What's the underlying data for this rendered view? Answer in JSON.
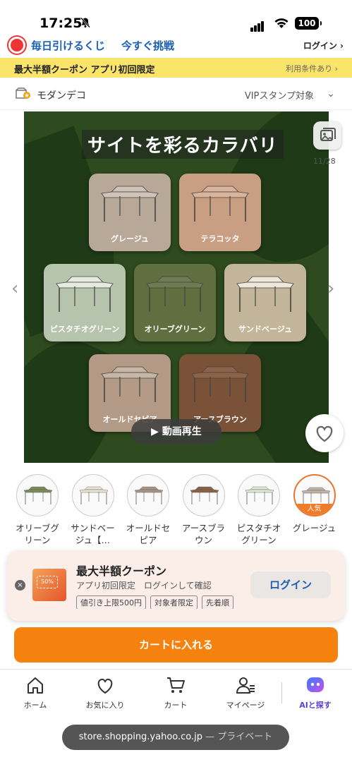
{
  "status_bar": {
    "time": "17:25",
    "battery": "100"
  },
  "lottery": {
    "label": "毎日引けるくじ",
    "cta": "今すぐ挑戦",
    "login": "ログイン ›"
  },
  "coupon_strip": {
    "text": "最大半額クーポン アプリ初回限定",
    "terms": "利用条件あり ›"
  },
  "store": {
    "name": "モダンデコ",
    "vip": "VIPスタンプ対象",
    "chevron": "⌄"
  },
  "hero": {
    "title": "サイトを彩るカラバリ",
    "counter": "11/28",
    "play_label": "▶ 動画再生",
    "swatches": [
      {
        "label": "グレージュ",
        "color": "#b8a898",
        "canopy": "#cfc4b5"
      },
      {
        "label": "テラコッタ",
        "color": "#c99f84",
        "canopy": "#d9b49a"
      },
      {
        "label": "ピスタチオグリーン",
        "color": "#b7c4ad",
        "canopy": "#e6ebe0"
      },
      {
        "label": "オリーブグリーン",
        "color": "#5f6f3f",
        "canopy": "#6f7b50"
      },
      {
        "label": "サンドベージュ",
        "color": "#c3b59a",
        "canopy": "#efe8da"
      },
      {
        "label": "オールドセピア",
        "color": "#b29a86",
        "canopy": "#c7b6a4"
      },
      {
        "label": "アースブラウン",
        "color": "#7a5238",
        "canopy": "#8d6247"
      }
    ]
  },
  "variants": [
    {
      "name": "オリーブグ\nリーン",
      "canopy": "#7d8a5c",
      "selected": false,
      "tag": ""
    },
    {
      "name": "サンドベー\nジュ【…",
      "canopy": "#e9e2d2",
      "selected": false,
      "tag": ""
    },
    {
      "name": "オールドセ\nピア",
      "canopy": "#a89484",
      "selected": false,
      "tag": ""
    },
    {
      "name": "アースブラ\nウン",
      "canopy": "#8a6248",
      "selected": false,
      "tag": ""
    },
    {
      "name": "ピスタチオ\nグリーン",
      "canopy": "#dfe7d5",
      "selected": false,
      "tag": ""
    },
    {
      "name": "グレージュ",
      "canopy": "#c1b3a3",
      "selected": true,
      "tag": "人気"
    }
  ],
  "coupon_popup": {
    "title": "最大半額クーポン",
    "subtitle": "アプリ初回限定　ログインして確認",
    "tags": [
      "値引き上限500円",
      "対象者限定",
      "先着順"
    ],
    "badge": "50%",
    "login_button": "ログイン",
    "close": "×"
  },
  "cart_button": "カートに入れる",
  "tabbar": [
    {
      "label": "ホーム",
      "icon": "home-icon"
    },
    {
      "label": "お気に入り",
      "icon": "heart-icon"
    },
    {
      "label": "カート",
      "icon": "cart-icon"
    },
    {
      "label": "マイページ",
      "icon": "user-icon"
    },
    {
      "label": "AIと探す",
      "icon": "ai-icon"
    }
  ],
  "url_pill": {
    "domain": "store.shopping.yahoo.co.jp",
    "suffix": " — プライベート"
  }
}
